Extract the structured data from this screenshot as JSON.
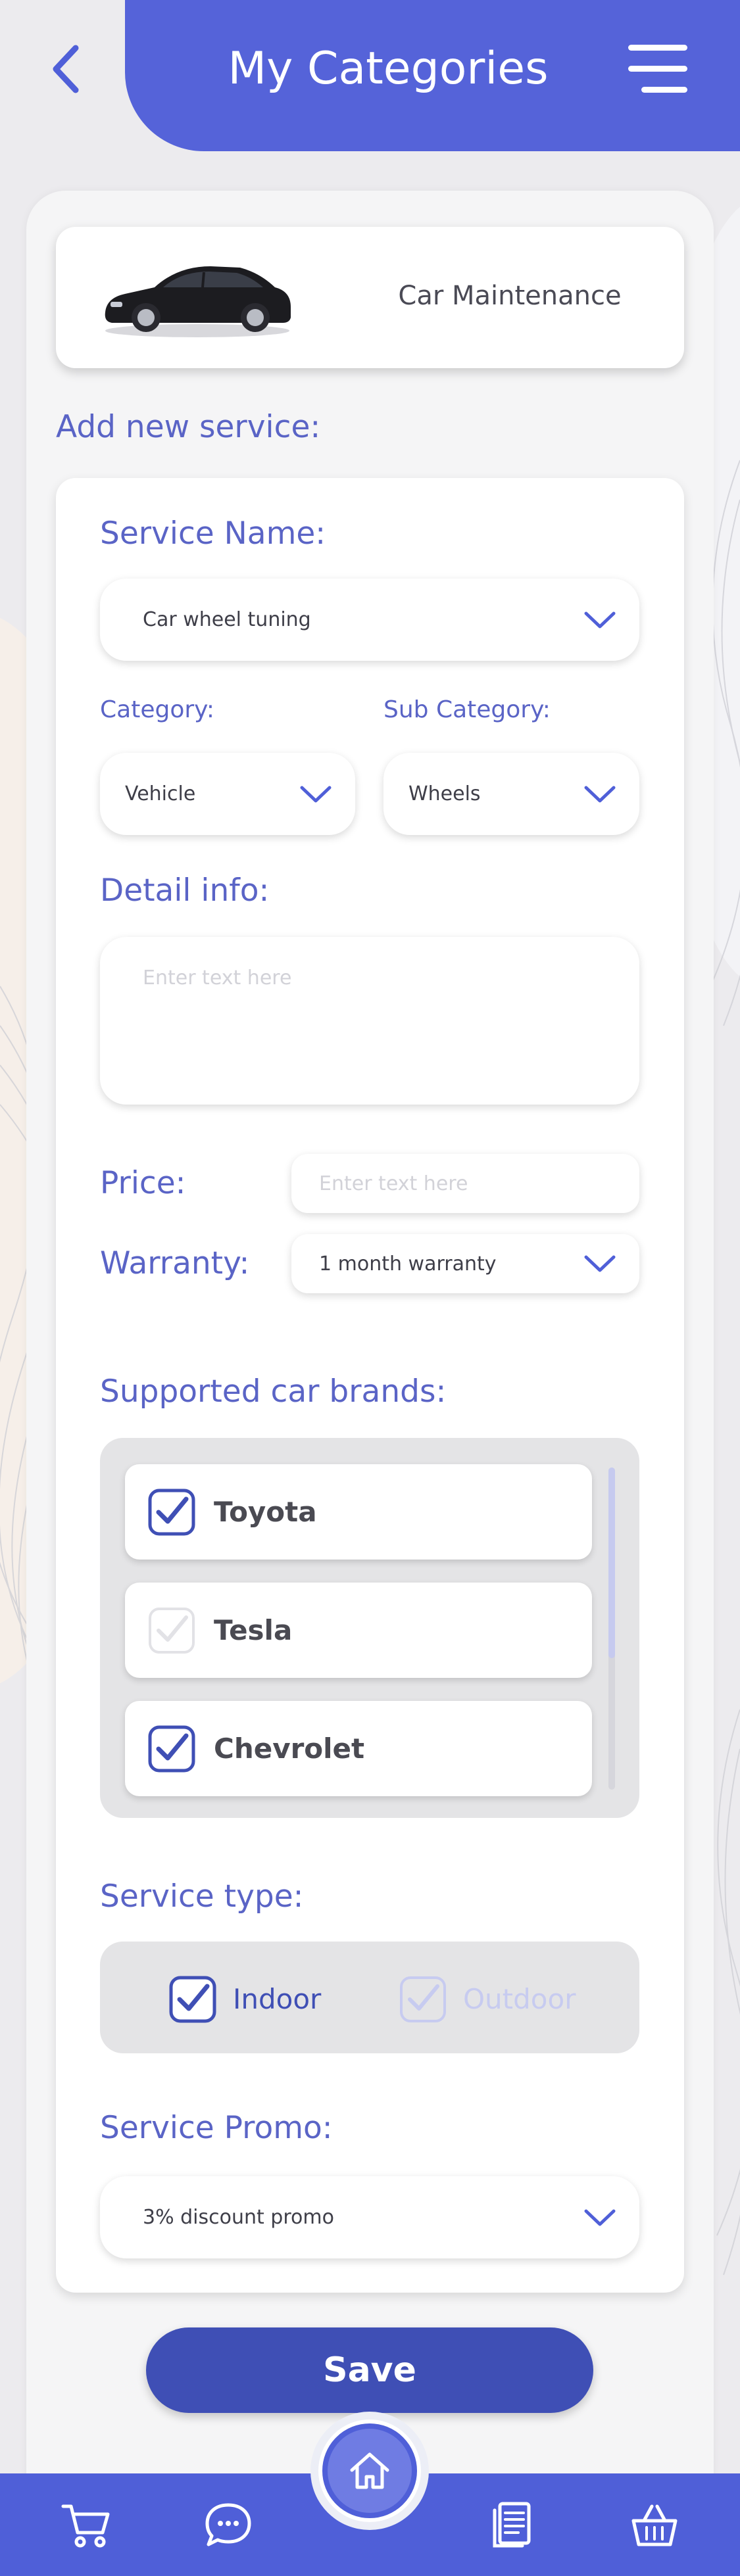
{
  "header": {
    "title": "My Categories"
  },
  "category_card": {
    "name": "Car Maintenance"
  },
  "form": {
    "section_title": "Add new service:",
    "service_name": {
      "label": "Service Name:",
      "value": "Car wheel tuning"
    },
    "category": {
      "label": "Category:",
      "value": "Vehicle"
    },
    "sub_category": {
      "label": "Sub Category:",
      "value": "Wheels"
    },
    "detail_info": {
      "label": "Detail info:",
      "placeholder": "Enter text here"
    },
    "price": {
      "label": "Price:",
      "placeholder": "Enter text here"
    },
    "warranty": {
      "label": "Warranty:",
      "value": "1 month warranty"
    },
    "brands": {
      "label": "Supported car brands:",
      "items": [
        {
          "name": "Toyota",
          "checked": true
        },
        {
          "name": "Tesla",
          "checked": false
        },
        {
          "name": "Chevrolet",
          "checked": true
        }
      ]
    },
    "service_type": {
      "label": "Service type:",
      "options": [
        {
          "name": "Indoor",
          "checked": true
        },
        {
          "name": "Outdoor",
          "checked": false
        }
      ]
    },
    "promo": {
      "label": "Service Promo:",
      "value": "3% discount promo"
    },
    "save_label": "Save"
  },
  "nav": {
    "items": [
      "cart-icon",
      "chat-icon",
      "home-icon",
      "orders-icon",
      "basket-icon"
    ]
  },
  "colors": {
    "accent": "#5563d9",
    "button": "#3f4fb5",
    "label": "#5a64c6"
  }
}
